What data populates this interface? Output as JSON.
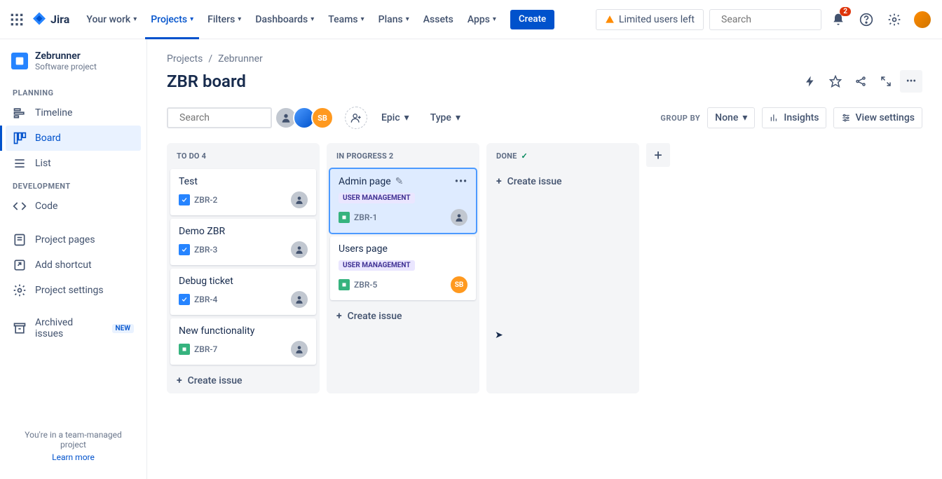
{
  "topnav": {
    "logo_text": "Jira",
    "items": [
      {
        "label": "Your work",
        "dropdown": true
      },
      {
        "label": "Projects",
        "dropdown": true,
        "active": true
      },
      {
        "label": "Filters",
        "dropdown": true
      },
      {
        "label": "Dashboards",
        "dropdown": true
      },
      {
        "label": "Teams",
        "dropdown": true
      },
      {
        "label": "Plans",
        "dropdown": true
      },
      {
        "label": "Assets",
        "dropdown": false
      },
      {
        "label": "Apps",
        "dropdown": true
      }
    ],
    "create_label": "Create",
    "limited_label": "Limited users left",
    "search_placeholder": "Search",
    "notification_count": "2"
  },
  "sidebar": {
    "project_name": "Zebrunner",
    "project_type": "Software project",
    "sections": {
      "planning_label": "PLANNING",
      "development_label": "DEVELOPMENT"
    },
    "planning_items": [
      {
        "label": "Timeline"
      },
      {
        "label": "Board",
        "active": true
      },
      {
        "label": "List"
      }
    ],
    "development_items": [
      {
        "label": "Code"
      }
    ],
    "other_items": [
      {
        "label": "Project pages"
      },
      {
        "label": "Add shortcut"
      },
      {
        "label": "Project settings"
      },
      {
        "label": "Archived issues",
        "badge": "NEW"
      }
    ],
    "footer_text": "You're in a team-managed project",
    "footer_link": "Learn more"
  },
  "breadcrumb": [
    "Projects",
    "Zebrunner"
  ],
  "board_title": "ZBR board",
  "filters": {
    "search_placeholder": "Search",
    "epic_label": "Epic",
    "type_label": "Type",
    "group_by_label": "GROUP BY",
    "group_by_value": "None",
    "insights_label": "Insights",
    "view_settings_label": "View settings",
    "avatar_initials": "SB"
  },
  "columns": [
    {
      "title": "TO DO",
      "count": "4",
      "cards": [
        {
          "title": "Test",
          "key": "ZBR-2",
          "type": "task",
          "assignee": "unassigned"
        },
        {
          "title": "Demo ZBR",
          "key": "ZBR-3",
          "type": "task",
          "assignee": "unassigned"
        },
        {
          "title": "Debug ticket",
          "key": "ZBR-4",
          "type": "task",
          "assignee": "unassigned"
        },
        {
          "title": "New functionality",
          "key": "ZBR-7",
          "type": "story",
          "assignee": "unassigned"
        }
      ],
      "create_label": "Create issue"
    },
    {
      "title": "IN PROGRESS",
      "count": "2",
      "cards": [
        {
          "title": "Admin page",
          "key": "ZBR-1",
          "type": "story",
          "tag": "USER MANAGEMENT",
          "assignee": "unassigned",
          "selected": true
        },
        {
          "title": "Users page",
          "key": "ZBR-5",
          "type": "story",
          "tag": "USER MANAGEMENT",
          "assignee": "SB"
        }
      ],
      "create_label": "Create issue"
    },
    {
      "title": "DONE",
      "done": true,
      "cards": [],
      "create_label": "Create issue"
    }
  ]
}
